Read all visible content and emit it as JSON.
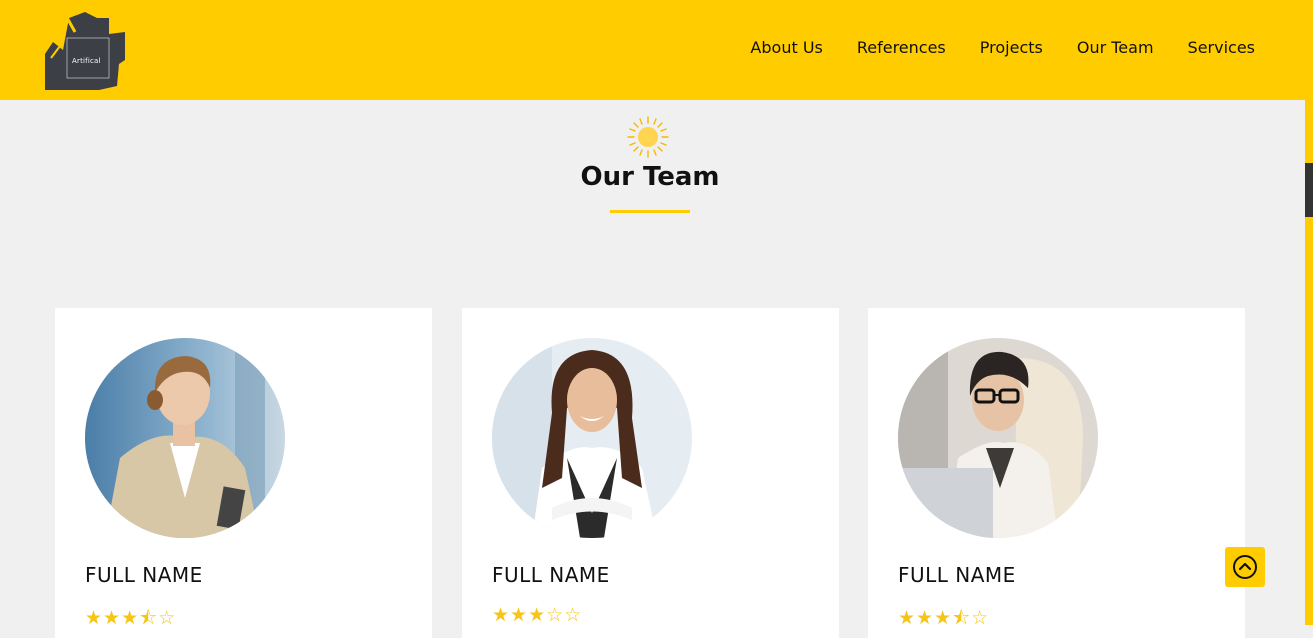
{
  "header": {
    "logo_text": "Artifical",
    "nav": [
      "About Us",
      "References",
      "Projects",
      "Our Team",
      "Services"
    ]
  },
  "section": {
    "title": "Our Team"
  },
  "team": [
    {
      "name": "FULL NAME",
      "stars": "★★★⯪☆",
      "rating": 3.5
    },
    {
      "name": "FULL NAME",
      "stars": "★★★☆☆",
      "rating": 3
    },
    {
      "name": "FULL NAME",
      "stars": "★★★⯪☆",
      "rating": 3.5
    }
  ],
  "colors": {
    "accent": "#ffcc00",
    "background": "#f0f0f0",
    "star": "#f5c518"
  }
}
